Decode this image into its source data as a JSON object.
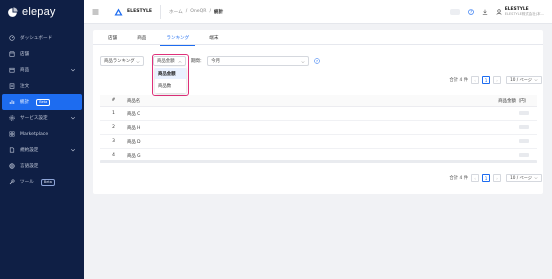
{
  "sidebar": {
    "logo_text": "elepay",
    "items": [
      {
        "label": "ダッシュボード",
        "icon": "gauge-icon"
      },
      {
        "label": "店舗",
        "icon": "store-icon"
      },
      {
        "label": "商品",
        "icon": "box-icon",
        "expandable": true
      },
      {
        "label": "注文",
        "icon": "order-icon"
      },
      {
        "label": "統計",
        "icon": "chart-icon",
        "badge": "Beta",
        "active": true
      },
      {
        "label": "サービス設定",
        "icon": "gear-icon",
        "expandable": true
      },
      {
        "label": "Marketplace",
        "icon": "grid-icon"
      },
      {
        "label": "規約設定",
        "icon": "document-icon",
        "expandable": true
      },
      {
        "label": "言語設定",
        "icon": "globe-icon"
      },
      {
        "label": "ツール",
        "icon": "wrench-icon",
        "badge": "Beta"
      }
    ]
  },
  "topbar": {
    "brand": "ELESTYLE",
    "breadcrumb": [
      "ホーム",
      "OneQR",
      "統計"
    ],
    "user_name": "ELESTYLE",
    "user_company": "ELESTYLE株式会社(本..."
  },
  "tabs": [
    "店舗",
    "商品",
    "ランキング",
    "端末"
  ],
  "active_tab": "ランキング",
  "filters": {
    "ranking_select": "商品ランキング",
    "metric_select": "商品金額",
    "period_label": "期間：",
    "period_select": "今月"
  },
  "dropdown": {
    "options": [
      "商品金額",
      "商品数"
    ],
    "selected": "商品金額"
  },
  "pagination": {
    "total_text": "合計 4 件",
    "current_page": "1",
    "page_size": "10 / ページ"
  },
  "table": {
    "headers": {
      "rank": "#",
      "name": "商品名",
      "amount": "商品金額（円）"
    },
    "rows": [
      {
        "rank": "1",
        "name": "商品 C"
      },
      {
        "rank": "2",
        "name": "商品 H"
      },
      {
        "rank": "3",
        "name": "商品 D"
      },
      {
        "rank": "4",
        "name": "商品 G"
      }
    ]
  },
  "colors": {
    "sidebar_bg": "#0f1f45",
    "accent": "#1d6cf0",
    "highlight": "#e0317a"
  }
}
